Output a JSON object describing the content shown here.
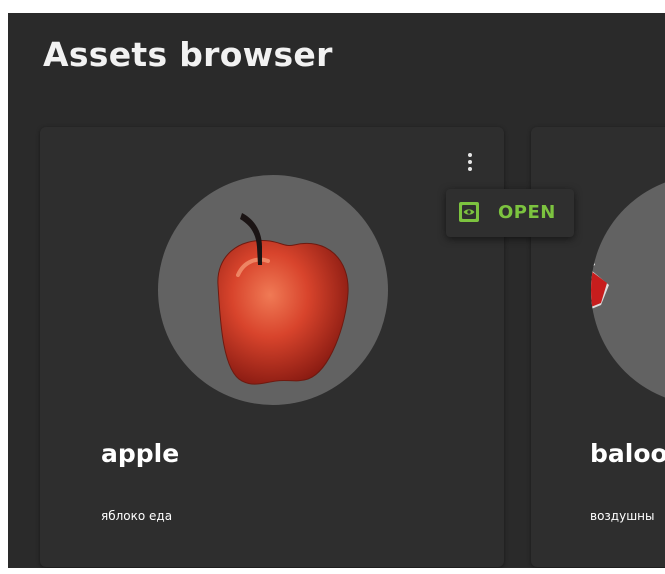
{
  "page": {
    "title": "Assets browser"
  },
  "cards": [
    {
      "title": "apple",
      "tags": "яблоко еда",
      "image": "apple-3d-model"
    },
    {
      "title": "baloo",
      "tags": "воздушны",
      "image": "balloon-3d-model"
    }
  ],
  "menu": {
    "open_label": "OPEN",
    "open_icon": "eye-icon"
  },
  "colors": {
    "background": "#2a2a2a",
    "card": "#2e2e2e",
    "thumb_circle": "#626262",
    "accent_green": "#7cc33f",
    "text": "#ffffff"
  }
}
